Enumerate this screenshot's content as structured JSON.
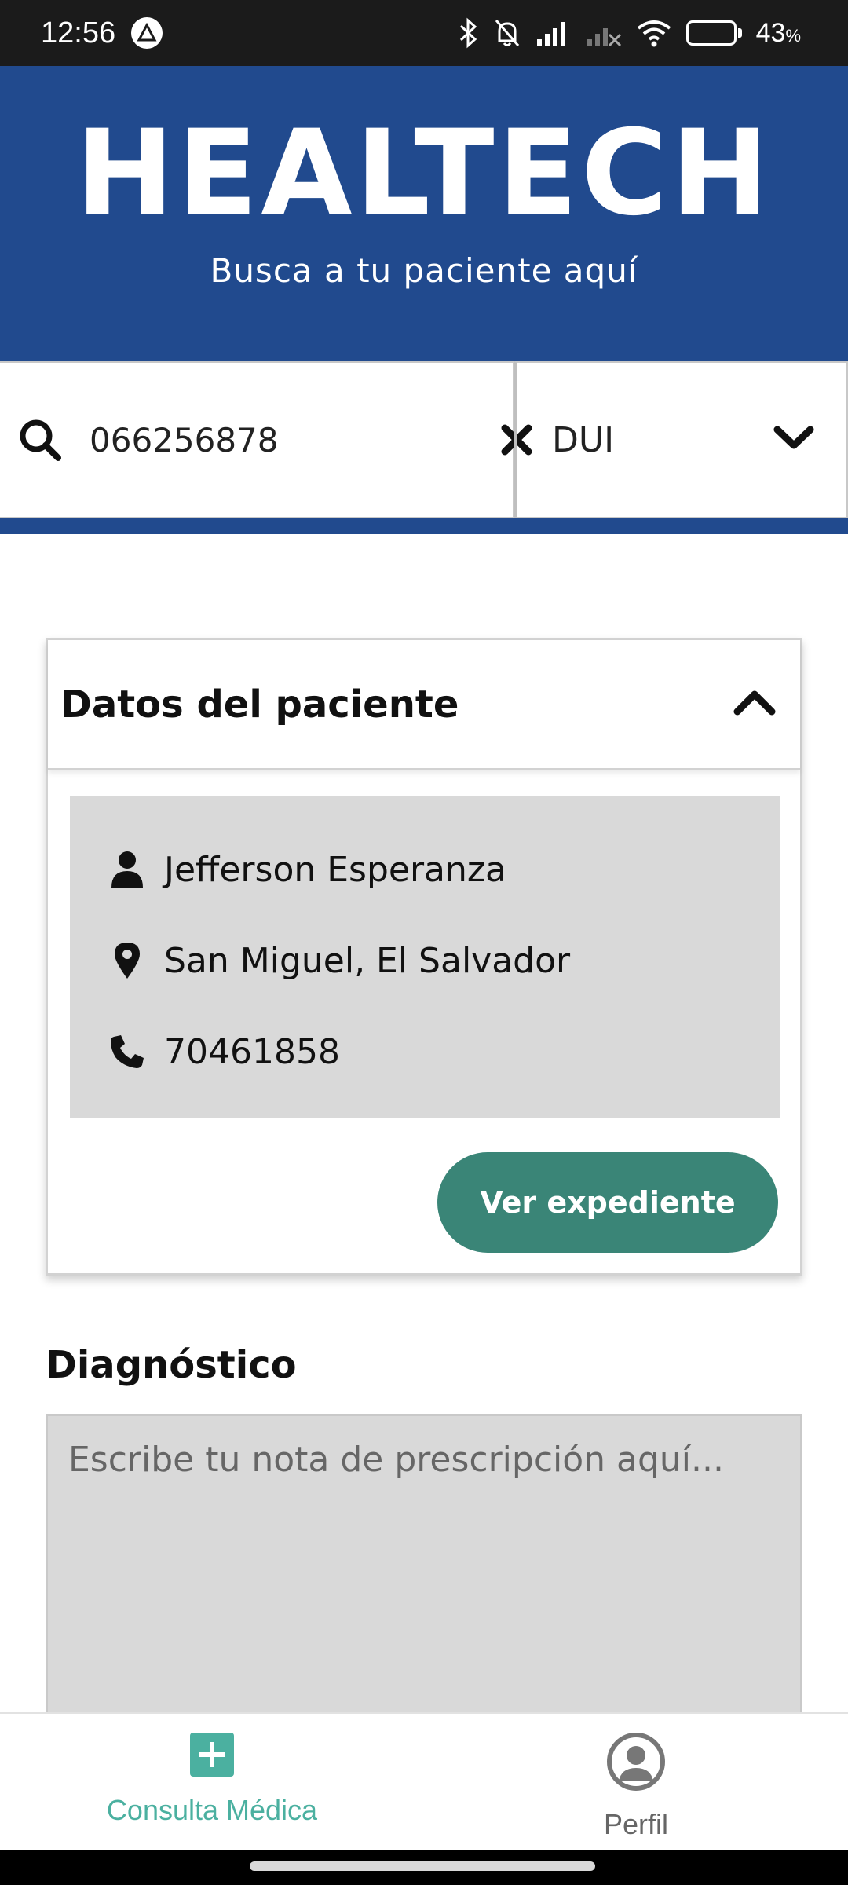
{
  "status_bar": {
    "time": "12:56",
    "battery_percent": "43",
    "battery_percent_sign": "%",
    "battery_level": 0.43,
    "icons": [
      "bluetooth-icon",
      "bell-off-icon",
      "signal-icon",
      "signal-off-icon",
      "wifi-icon",
      "battery-icon"
    ]
  },
  "header": {
    "title": "HEALTECH",
    "subtitle": "Busca a tu paciente aquí"
  },
  "search": {
    "value": "066256878",
    "doc_type": "DUI"
  },
  "patient_card": {
    "title": "Datos del paciente",
    "name": "Jefferson Esperanza",
    "location": "San Miguel, El Salvador",
    "phone": "70461858",
    "button_label": "Ver expediente"
  },
  "diagnosis": {
    "title": "Diagnóstico",
    "placeholder": "Escribe tu nota de prescripción aquí..."
  },
  "bottom_nav": {
    "items": [
      {
        "label": "Consulta Médica",
        "icon": "plus-square-icon",
        "active": true
      },
      {
        "label": "Perfil",
        "icon": "user-circle-icon",
        "active": false
      }
    ]
  },
  "colors": {
    "brand_blue": "#214a8e",
    "button_teal": "#3a8577",
    "nav_active": "#4bb0a0",
    "panel_gray": "#d9d9d9"
  }
}
